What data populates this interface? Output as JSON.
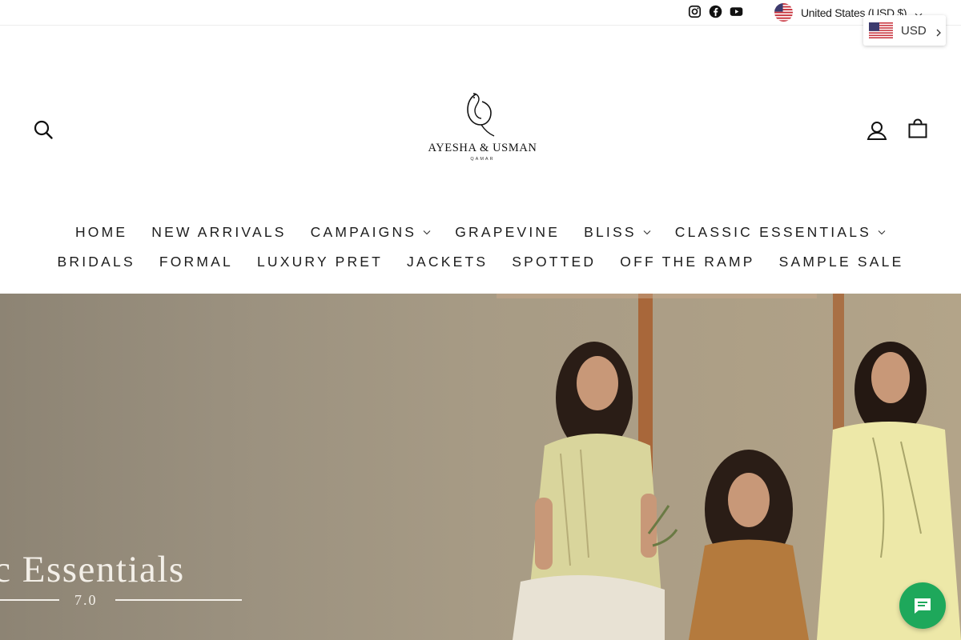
{
  "topbar": {
    "social": [
      "instagram-icon",
      "facebook-icon",
      "youtube-icon"
    ],
    "country_label": "United States (USD $)"
  },
  "currency_popup": {
    "label": "USD"
  },
  "header": {
    "search_icon": "search-icon",
    "account_icon": "user-icon",
    "cart_icon": "bag-icon"
  },
  "logo": {
    "brand": "AYESHA & USMAN",
    "sub": "QAMAR"
  },
  "nav": {
    "row1": [
      {
        "label": "HOME",
        "dropdown": false
      },
      {
        "label": "NEW ARRIVALS",
        "dropdown": false
      },
      {
        "label": "CAMPAIGNS",
        "dropdown": true
      },
      {
        "label": "GRAPEVINE",
        "dropdown": false
      },
      {
        "label": "BLISS",
        "dropdown": true
      },
      {
        "label": "CLASSIC ESSENTIALS",
        "dropdown": true
      }
    ],
    "row2": [
      {
        "label": "BRIDALS",
        "dropdown": false
      },
      {
        "label": "FORMAL",
        "dropdown": false
      },
      {
        "label": "LUXURY PRET",
        "dropdown": false
      },
      {
        "label": "JACKETS",
        "dropdown": false
      },
      {
        "label": "SPOTTED",
        "dropdown": false
      },
      {
        "label": "OFF THE RAMP",
        "dropdown": false
      },
      {
        "label": "SAMPLE SALE",
        "dropdown": false
      }
    ]
  },
  "hero": {
    "title": "ssic Essentials",
    "subtitle": "7.0"
  },
  "colors": {
    "chat": "#1ea85b",
    "hero_text": "#f3efe8"
  }
}
